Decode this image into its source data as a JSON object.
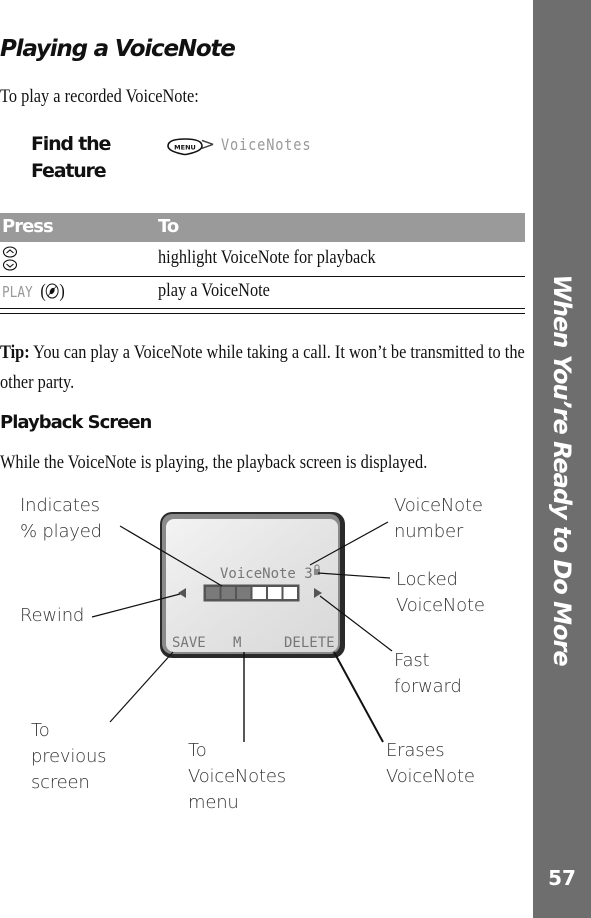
{
  "section": {
    "title": "Playing a VoiceNote",
    "intro": "To play a recorded VoiceNote:"
  },
  "find_feature": {
    "label_line1": "Find the",
    "label_line2": "Feature",
    "key_icon": "menu-key-icon",
    "key_text": "MENU",
    "separator": ">",
    "path": "VoiceNotes"
  },
  "table": {
    "headers": [
      "Press",
      "To"
    ],
    "rows": [
      {
        "press_icon": "scroll-up-down-keys-icon",
        "press": "",
        "to": "highlight VoiceNote for playback"
      },
      {
        "press_icon": "select-key-icon",
        "press": "PLAY",
        "to": "play a VoiceNote"
      }
    ]
  },
  "tip": {
    "label": "Tip:",
    "text": " You can play a VoiceNote while taking a call. It won’t be transmitted to the other party."
  },
  "playback": {
    "heading": "Playback Screen",
    "description": "While the VoiceNote is playing, the playback screen is displayed."
  },
  "phone_screen": {
    "title": "VoiceNote 3",
    "lock_icon": "lock-icon",
    "progress_fraction": 0.5,
    "progress_segments": 6,
    "rewind_icon": "rewind-arrow-icon",
    "forward_icon": "fast-forward-arrow-icon",
    "softkey_left": "SAVE",
    "softkey_center": "M",
    "softkey_right": "DELETE"
  },
  "callouts": {
    "percent_played": [
      "Indicates",
      "% played"
    ],
    "rewind": [
      "Rewind"
    ],
    "previous_screen": [
      "To",
      "previous",
      "screen"
    ],
    "voicenotes_menu": [
      "To",
      "VoiceNotes",
      "menu"
    ],
    "voicenote_number": [
      "VoiceNote",
      "number"
    ],
    "locked": [
      "Locked",
      "VoiceNote"
    ],
    "fast_forward": [
      "Fast",
      "forward"
    ],
    "erases": [
      "Erases",
      "VoiceNote"
    ]
  },
  "sidebar": {
    "chapter_title": "When You’re Ready to Do More",
    "page_number": "57"
  },
  "colors": {
    "sidebar_bg": "#6e6e6e",
    "table_header_bg": "#9a9a9a",
    "progress_filled": "#7a7a7a",
    "progress_empty": "#ffffff"
  }
}
